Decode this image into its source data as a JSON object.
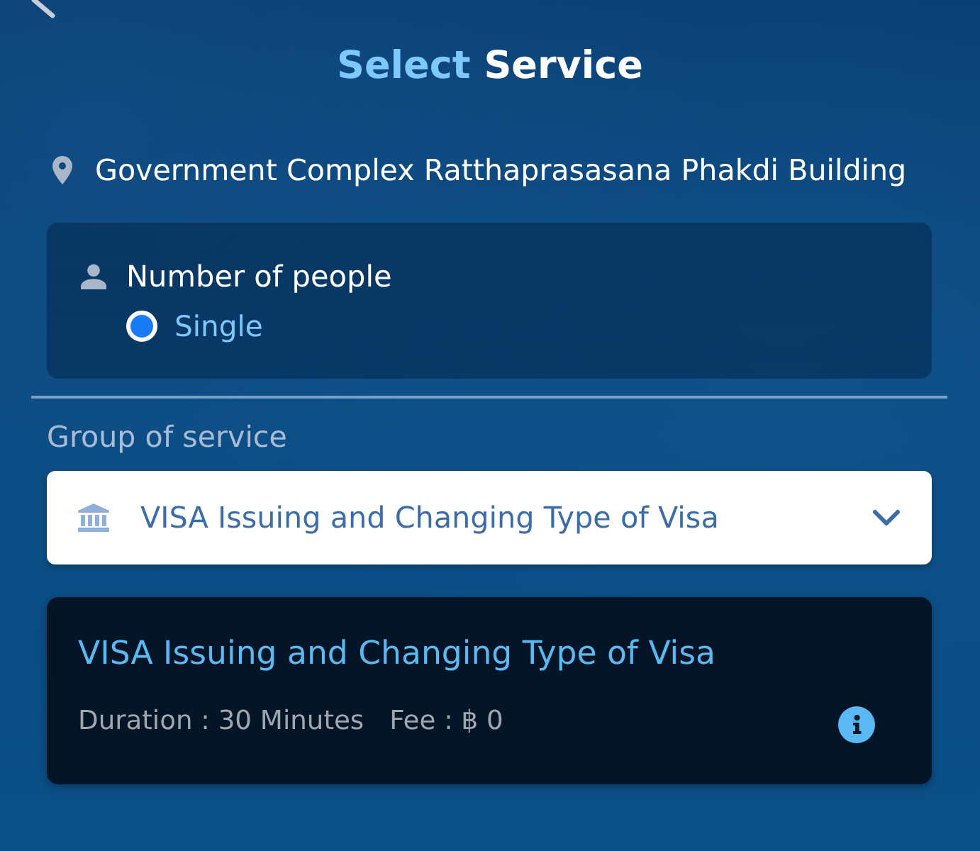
{
  "title": {
    "accent": "Select",
    "main": "Service"
  },
  "location": {
    "name": "Government Complex Ratthaprasasana Phakdi Building"
  },
  "people": {
    "label": "Number of people",
    "options": [
      {
        "label": "Single",
        "selected": true
      }
    ]
  },
  "service_group": {
    "label": "Group of service",
    "value": "VISA Issuing and Changing Type of Visa"
  },
  "services": [
    {
      "name": "VISA Issuing and Changing Type of Visa",
      "duration": "Duration : 30 Minutes",
      "fee": "Fee : ฿ 0"
    }
  ]
}
